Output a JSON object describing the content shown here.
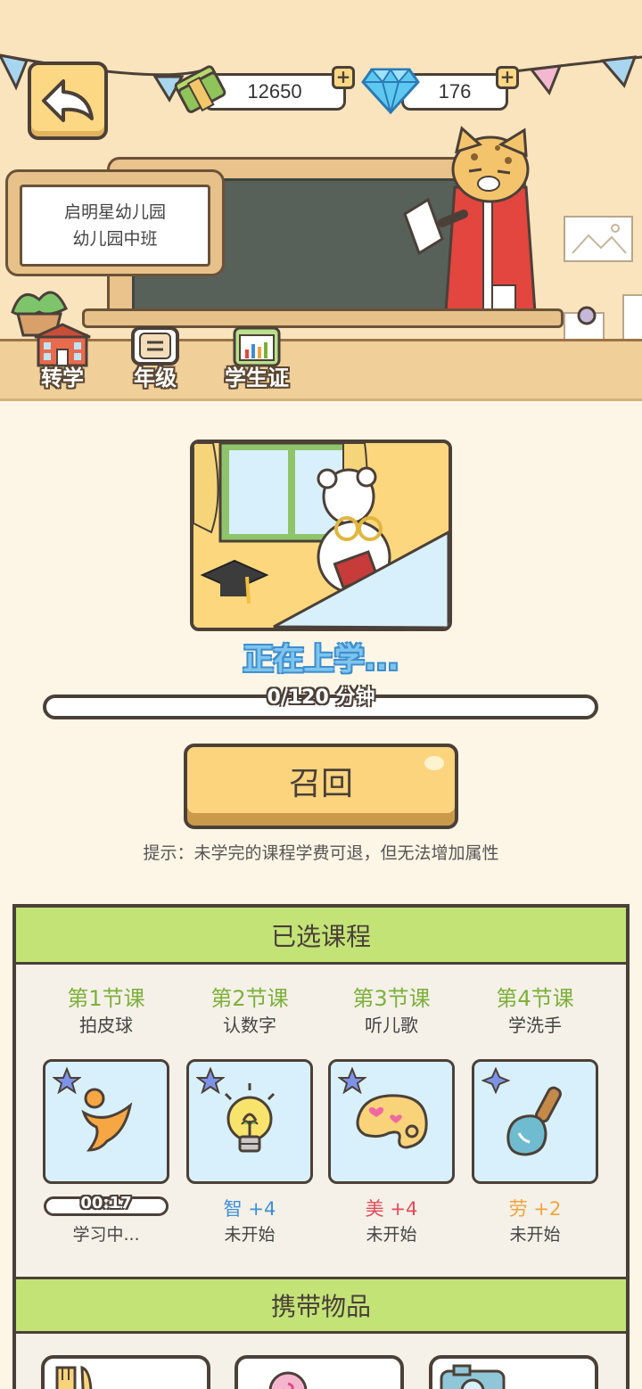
{
  "header": {
    "cash": "12650",
    "gems": "176",
    "plus_symbol": "+"
  },
  "school_sign": {
    "school": "启明星幼儿园",
    "class": "幼儿园中班"
  },
  "scene_nav": [
    {
      "label": "转学",
      "icon": "school-building-icon"
    },
    {
      "label": "年级",
      "icon": "grade-book-icon"
    },
    {
      "label": "学生证",
      "icon": "student-id-icon"
    }
  ],
  "status": {
    "text": "正在上学...",
    "progress_label": "0/120 分钟",
    "progress_fraction": 0
  },
  "recall_button": "召回",
  "hint": "提示：未学完的课程学费可退，但无法增加属性",
  "selected_courses": {
    "title": "已选课程",
    "courses": [
      {
        "lesson": "第1节课",
        "name": "拍皮球",
        "icon": "running-person-icon",
        "timer": "00:17",
        "status": "学习中..."
      },
      {
        "lesson": "第2节课",
        "name": "认数字",
        "icon": "light-bulb-icon",
        "attr_name": "智",
        "attr_value": "+4",
        "status": "未开始"
      },
      {
        "lesson": "第3节课",
        "name": "听儿歌",
        "icon": "paint-palette-icon",
        "attr_name": "美",
        "attr_value": "+4",
        "status": "未开始"
      },
      {
        "lesson": "第4节课",
        "name": "学洗手",
        "icon": "shovel-icon",
        "attr_name": "劳",
        "attr_value": "+2",
        "status": "未开始"
      }
    ]
  },
  "carried_items": {
    "title": "携带物品",
    "items": [
      {
        "icon": "fork-knife-icon"
      },
      {
        "icon": "lollipop-icon"
      },
      {
        "icon": "camera-icon"
      }
    ]
  },
  "colors": {
    "panel_header": "#c3e377",
    "lesson_green": "#7db03a",
    "card_blue": "#d8f0fb",
    "button_yellow": "#fcd47e",
    "intelligence": "#3d8fd8",
    "beauty": "#e24b5a",
    "labor": "#f0a43c"
  }
}
